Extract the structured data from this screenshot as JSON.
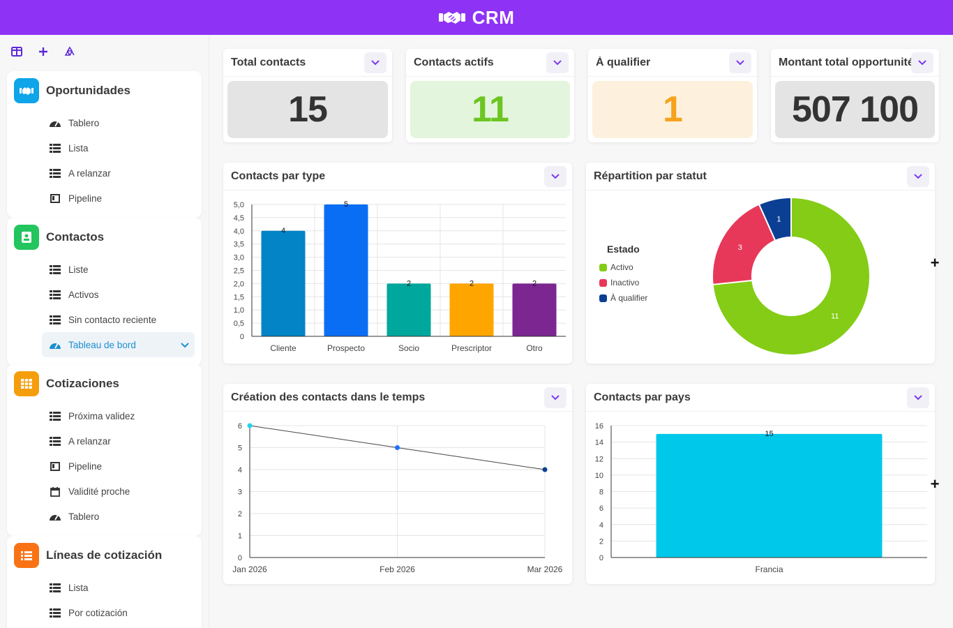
{
  "header": {
    "title": "CRM"
  },
  "sidebar": {
    "tools": [
      "panel-icon",
      "plus-icon",
      "recycle-icon"
    ],
    "sections": [
      {
        "title": "Oportunidades",
        "color": "#0ea5e9",
        "items": [
          {
            "label": "Tablero",
            "icon": "gauge-icon"
          },
          {
            "label": "Lista",
            "icon": "list-icon"
          },
          {
            "label": "A relanzar",
            "icon": "list-icon"
          },
          {
            "label": "Pipeline",
            "icon": "columns-icon"
          }
        ]
      },
      {
        "title": "Contactos",
        "color": "#22c55e",
        "items": [
          {
            "label": "Liste",
            "icon": "list-icon"
          },
          {
            "label": "Activos",
            "icon": "list-icon"
          },
          {
            "label": "Sin contacto reciente",
            "icon": "list-icon"
          },
          {
            "label": "Tableau de bord",
            "icon": "gauge-icon",
            "active": true
          }
        ]
      },
      {
        "title": "Cotizaciones",
        "color": "#f59e0b",
        "items": [
          {
            "label": "Próxima validez",
            "icon": "list-icon"
          },
          {
            "label": "A relanzar",
            "icon": "list-icon"
          },
          {
            "label": "Pipeline",
            "icon": "columns-icon"
          },
          {
            "label": "Validité proche",
            "icon": "calendar-icon"
          },
          {
            "label": "Tablero",
            "icon": "gauge-icon"
          }
        ]
      },
      {
        "title": "Líneas de cotización",
        "color": "#f97316",
        "items": [
          {
            "label": "Lista",
            "icon": "list-icon"
          },
          {
            "label": "Por cotización",
            "icon": "list-icon"
          }
        ]
      }
    ]
  },
  "kpis": [
    {
      "title": "Total contacts",
      "value": "15",
      "bg": "#e4e4e4",
      "fg": "#333333"
    },
    {
      "title": "Contacts actifs",
      "value": "11",
      "bg": "#e3f5dc",
      "fg": "#6cc521"
    },
    {
      "title": "À qualifier",
      "value": "1",
      "bg": "#fdf1de",
      "fg": "#f6a31c"
    },
    {
      "title": "Montant total opportunités",
      "value": "507 100",
      "bg": "#e4e4e4",
      "fg": "#333333"
    }
  ],
  "charts": {
    "by_type": {
      "title": "Contacts par type"
    },
    "by_status": {
      "title": "Répartition par statut"
    },
    "over_time": {
      "title": "Création des contacts dans le temps"
    },
    "by_country": {
      "title": "Contacts par pays"
    }
  },
  "chart_data": [
    {
      "type": "bar",
      "categories": [
        "Cliente",
        "Prospecto",
        "Socio",
        "Prescriptor",
        "Otro"
      ],
      "values": [
        4,
        5,
        2,
        2,
        2
      ],
      "colors": [
        "#0284c7",
        "#0a6ef5",
        "#00a79d",
        "#ffa500",
        "#7b2691"
      ],
      "ylim": [
        0,
        5
      ],
      "yticks": [
        "0",
        "0,5",
        "1,0",
        "1,5",
        "2,0",
        "2,5",
        "3,0",
        "3,5",
        "4,0",
        "4,5",
        "5,0"
      ],
      "grid": true
    },
    {
      "type": "pie",
      "legend_title": "Estado",
      "legend_position": "left",
      "series": [
        {
          "name": "Activo",
          "value": 11,
          "color": "#84cc16"
        },
        {
          "name": "Inactivo",
          "value": 3,
          "color": "#e7385a"
        },
        {
          "name": "À qualifier",
          "value": 1,
          "color": "#0a3f94"
        }
      ]
    },
    {
      "type": "line",
      "x": [
        "Jan 2026",
        "Feb 2026",
        "Mar 2026"
      ],
      "values": [
        6,
        5,
        4
      ],
      "ylim": [
        0,
        6
      ],
      "yticks": [
        "0",
        "1",
        "2",
        "3",
        "4",
        "5",
        "6"
      ],
      "grid": true
    },
    {
      "type": "bar",
      "categories": [
        "Francia"
      ],
      "values": [
        15
      ],
      "colors": [
        "#00c8ea"
      ],
      "ylim": [
        0,
        16
      ],
      "yticks": [
        "0",
        "2",
        "4",
        "6",
        "8",
        "10",
        "12",
        "14",
        "16"
      ],
      "grid": true
    }
  ],
  "side_actions": [
    "+",
    "+"
  ]
}
